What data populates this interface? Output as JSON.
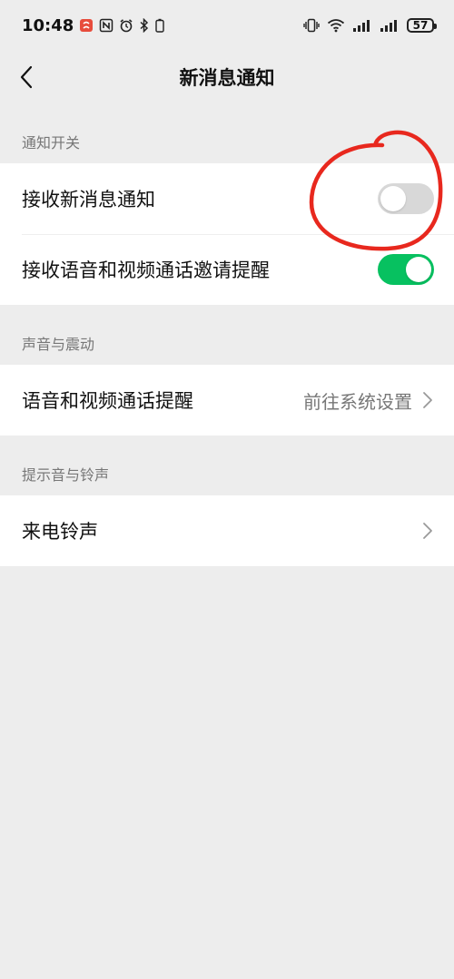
{
  "status_bar": {
    "time": "10:48",
    "battery": "57",
    "icons": [
      "app-notification-icon",
      "nfc-icon",
      "alarm-icon",
      "bluetooth-icon",
      "vibrate-icon",
      "wifi-icon",
      "signal-icon",
      "signal-icon",
      "battery-icon"
    ]
  },
  "nav": {
    "title": "新消息通知",
    "back_icon": "back-icon"
  },
  "sections": [
    {
      "header": "通知开关"
    },
    {
      "header": "声音与震动"
    },
    {
      "header": "提示音与铃声"
    }
  ],
  "rows": {
    "receive_new_message": {
      "label": "接收新消息通知",
      "enabled": false
    },
    "receive_call_invite": {
      "label": "接收语音和视频通话邀请提醒",
      "enabled": true
    },
    "call_reminder": {
      "label": "语音和视频通话提醒",
      "value": "前往系统设置"
    },
    "ringtone": {
      "label": "来电铃声"
    }
  },
  "colors": {
    "toggle_on": "#07c160",
    "toggle_off": "#d8d8d8",
    "annotation": "#e8281e",
    "background": "#ededed"
  }
}
